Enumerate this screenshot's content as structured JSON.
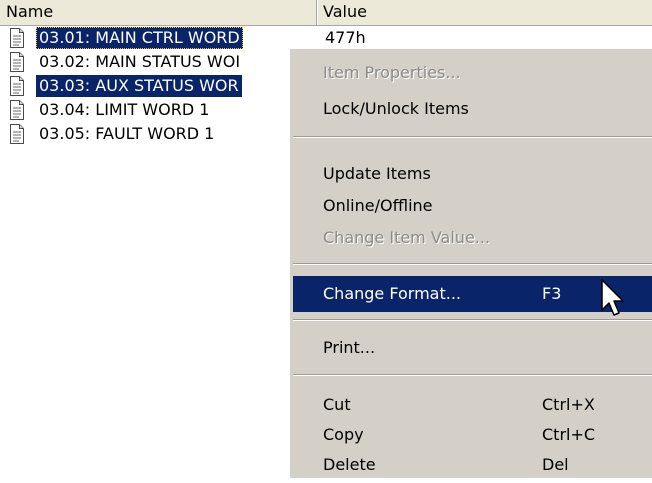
{
  "columns": {
    "name": "Name",
    "value": "Value"
  },
  "rows": [
    {
      "label": "03.01: MAIN CTRL WORD",
      "selected": true,
      "focused": true,
      "value": "477h"
    },
    {
      "label": "03.02: MAIN STATUS WOI",
      "selected": false
    },
    {
      "label": "03.03: AUX STATUS WOR",
      "selected": true
    },
    {
      "label": "03.04: LIMIT WORD 1",
      "selected": false
    },
    {
      "label": "03.05: FAULT WORD 1",
      "selected": false
    }
  ],
  "context_menu": {
    "item_properties": "Item Properties...",
    "lock_unlock": "Lock/Unlock Items",
    "update_items": "Update Items",
    "online_offline": "Online/Offline",
    "change_item_value": "Change Item Value...",
    "change_format": "Change Format...",
    "change_format_shortcut": "F3",
    "print": "Print...",
    "cut": "Cut",
    "cut_shortcut": "Ctrl+X",
    "copy": "Copy",
    "copy_shortcut": "Ctrl+C",
    "delete": "Delete",
    "delete_shortcut": "Del"
  },
  "colors": {
    "selection": "#0a246a",
    "menu_background": "#d4d0c8",
    "header_background": "#ece9d8",
    "disabled_text": "#8d8b86"
  }
}
